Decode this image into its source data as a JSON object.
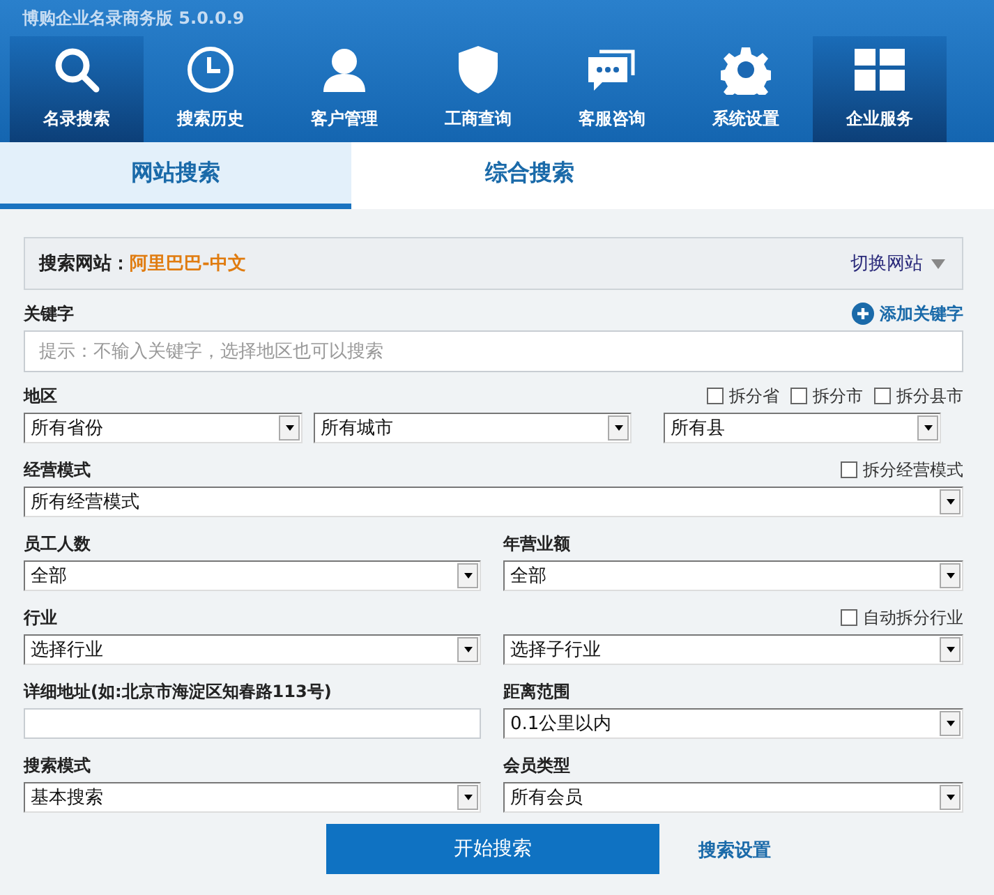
{
  "window": {
    "title": "博购企业名录商务版 5.0.0.9"
  },
  "nav": [
    {
      "label": "名录搜索",
      "selected": true
    },
    {
      "label": "搜索历史",
      "selected": false
    },
    {
      "label": "客户管理",
      "selected": false
    },
    {
      "label": "工商查询",
      "selected": false
    },
    {
      "label": "客服咨询",
      "selected": false
    },
    {
      "label": "系统设置",
      "selected": false
    },
    {
      "label": "企业服务",
      "selected": true
    }
  ],
  "tabs": [
    {
      "label": "网站搜索",
      "selected": true
    },
    {
      "label": "综合搜索",
      "selected": false
    }
  ],
  "site": {
    "label": "搜索网站：",
    "value": "阿里巴巴-中文",
    "switch": "切换网站"
  },
  "keyword": {
    "label": "关键字",
    "add": "添加关键字",
    "placeholder": "提示：不输入关键字，选择地区也可以搜索"
  },
  "region": {
    "label": "地区",
    "options": [
      {
        "label": "拆分省",
        "checked": false
      },
      {
        "label": "拆分市",
        "checked": false
      },
      {
        "label": "拆分县市",
        "checked": false
      }
    ],
    "selects": [
      "所有省份",
      "所有城市",
      "所有县"
    ]
  },
  "business_mode": {
    "label": "经营模式",
    "option": {
      "label": "拆分经营模式",
      "checked": false
    },
    "select": "所有经营模式"
  },
  "staff": {
    "label": "员工人数",
    "select": "全部"
  },
  "revenue": {
    "label": "年营业额",
    "select": "全部"
  },
  "industry": {
    "label": "行业",
    "option": {
      "label": "自动拆分行业",
      "checked": false
    },
    "selects": [
      "选择行业",
      "选择子行业"
    ]
  },
  "address": {
    "label": "详细地址(如:北京市海淀区知春路113号)"
  },
  "distance": {
    "label": "距离范围",
    "select": "0.1公里以内"
  },
  "search_mode": {
    "label": "搜索模式",
    "select": "基本搜索"
  },
  "member_type": {
    "label": "会员类型",
    "select": "所有会员"
  },
  "footer": {
    "button": "开始搜索",
    "link": "搜索设置"
  }
}
